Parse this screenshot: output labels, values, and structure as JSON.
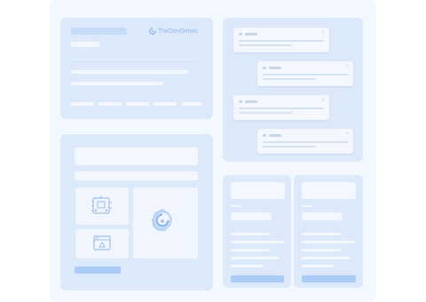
{
  "brand": {
    "name": "TheDevDenim",
    "logo_icon": "logo-icon"
  },
  "notifications": [
    {
      "close": "×"
    },
    {
      "close": "×"
    },
    {
      "close": "×"
    },
    {
      "close": "×"
    }
  ],
  "colors": {
    "page": "#ffffff",
    "board": "#f3f7fe",
    "card": "#dce9fb",
    "placeholder_light": "#f4f8fe",
    "placeholder_mid": "#c4dbf8",
    "accent": "#a9cbf5",
    "brand_text": "#8fb7ef"
  }
}
